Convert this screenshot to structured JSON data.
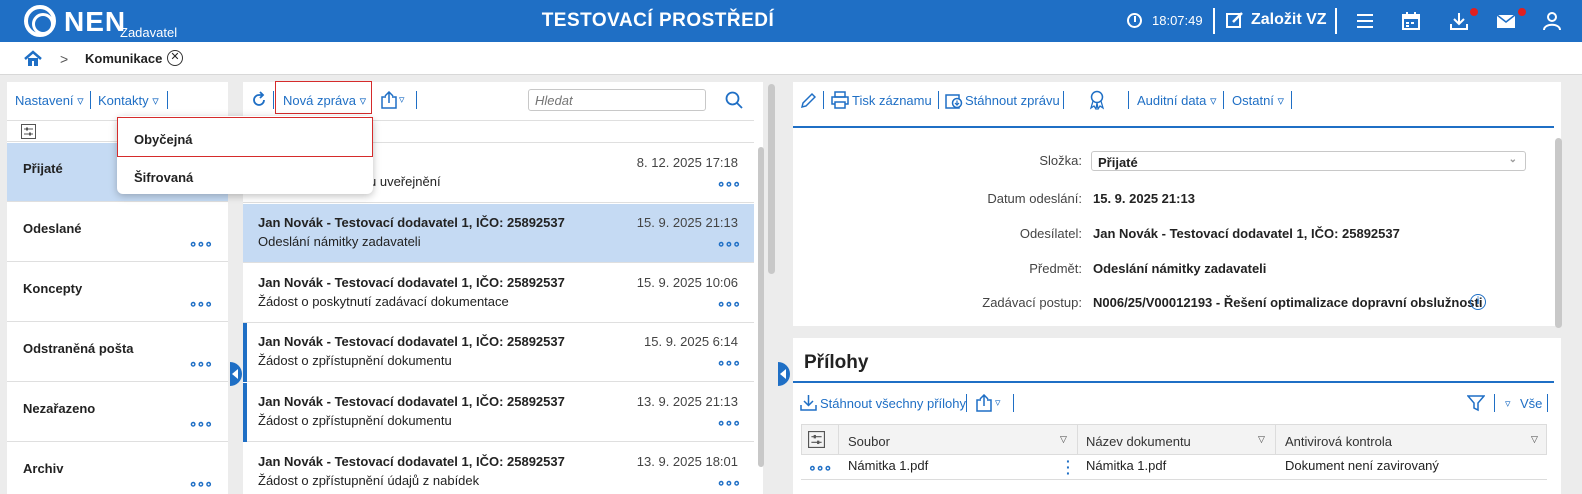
{
  "header": {
    "logo_text": "NEN",
    "logo_sub": "Zadavatel",
    "env_title": "TESTOVACÍ PROSTŘEDÍ",
    "time": "18:07:49",
    "create_label": "Založit VZ",
    "accent": "#1f6fc5",
    "notification_color": "#e02020"
  },
  "breadcrumb": {
    "current": "Komunikace"
  },
  "left_toolbar": {
    "settings": "Nastavení ▿",
    "contacts": "Kontakty ▿"
  },
  "folders": [
    {
      "label": "Přijaté"
    },
    {
      "label": "Odeslané"
    },
    {
      "label": "Koncepty"
    },
    {
      "label": "Odstraněná pošta"
    },
    {
      "label": "Nezařazeno"
    },
    {
      "label": "Archiv"
    }
  ],
  "new_message_menu": {
    "button": "Nová zpráva ▿",
    "items": [
      "Obyčejná",
      "Šifrovaná"
    ]
  },
  "search": {
    "placeholder": "Hledat"
  },
  "messages": [
    {
      "sender": "",
      "date": "8. 12. 2025 17:18",
      "subject": "u uveřejnění"
    },
    {
      "sender": "Jan Novák - Testovací dodavatel 1, IČO: 25892537",
      "date": "15. 9. 2025 21:13",
      "subject": "Odeslání námitky zadavateli"
    },
    {
      "sender": "Jan Novák - Testovací dodavatel 1, IČO: 25892537",
      "date": "15. 9. 2025 10:06",
      "subject": "Žádost o poskytnutí zadávací dokumentace"
    },
    {
      "sender": "Jan Novák - Testovací dodavatel 1, IČO: 25892537",
      "date": "15. 9. 2025 6:14",
      "subject": "Žádost o zpřístupnění dokumentu"
    },
    {
      "sender": "Jan Novák - Testovací dodavatel 1, IČO: 25892537",
      "date": "13. 9. 2025 21:13",
      "subject": "Žádost o zpřístupnění dokumentu"
    },
    {
      "sender": "Jan Novák - Testovací dodavatel 1, IČO: 25892537",
      "date": "13. 9. 2025 18:01",
      "subject": "Žádost o zpřístupnění údajů z nabídek"
    }
  ],
  "detail_toolbar": {
    "print": "Tisk záznamu",
    "download": "Stáhnout zprávu",
    "audit": "Auditní data ▿",
    "other": "Ostatní ▿"
  },
  "detail": {
    "folder_label": "Složka:",
    "folder_value": "Přijaté",
    "sent_label": "Datum odeslání:",
    "sent_value": "15. 9. 2025 21:13",
    "sender_label": "Odesílatel:",
    "sender_value": "Jan Novák - Testovací dodavatel 1, IČO: 25892537",
    "subject_label": "Předmět:",
    "subject_value": "Odeslání námitky zadavateli",
    "procedure_label": "Zadávací postup:",
    "procedure_value": "N006/25/V00012193 - Řešení optimalizace dopravní obslužnosti"
  },
  "attachments": {
    "title": "Přílohy",
    "download_all": "Stáhnout všechny přílohy",
    "all_label": "Vše",
    "columns": [
      "Soubor",
      "Název dokumentu",
      "Antivirová kontrola"
    ],
    "rows": [
      {
        "file": "Námitka 1.pdf",
        "doc": "Námitka 1.pdf",
        "av": "Dokument není zavirovaný"
      }
    ]
  }
}
